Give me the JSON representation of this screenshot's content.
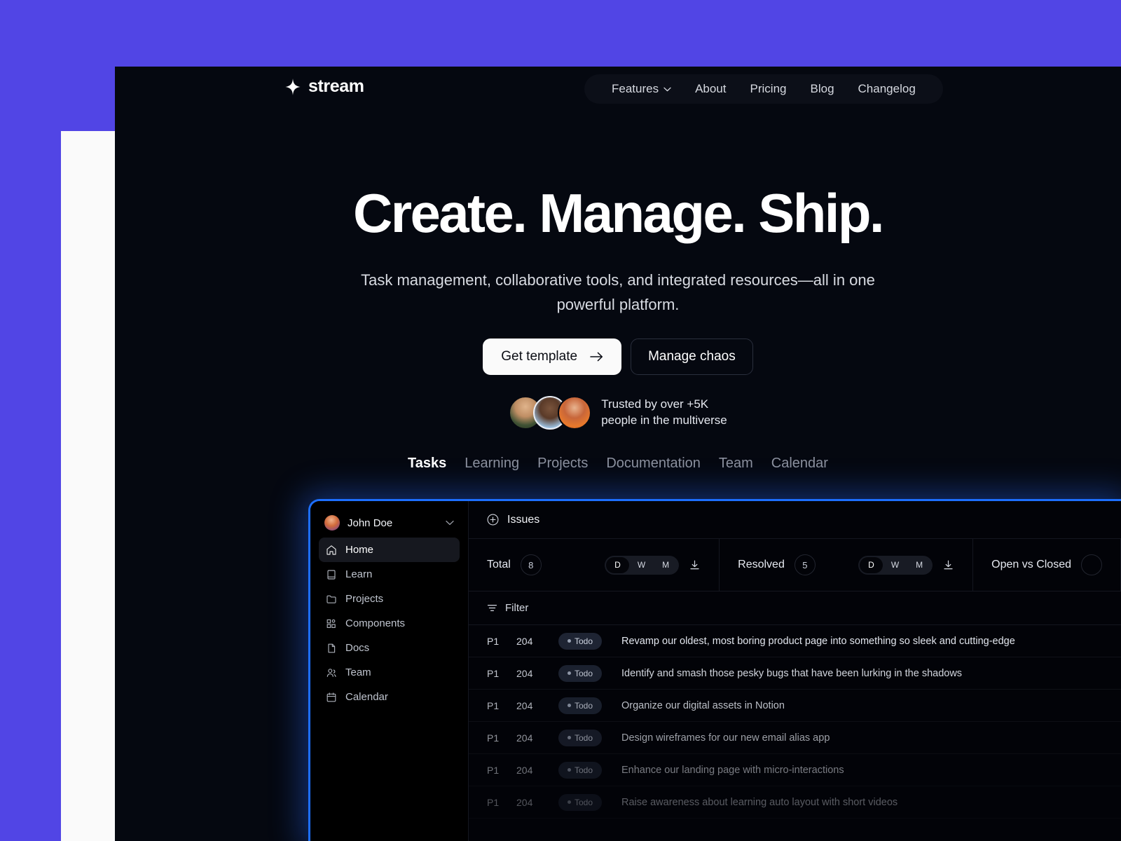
{
  "brand": {
    "name": "stream",
    "logo_icon": "sparkle-star-icon"
  },
  "nav": {
    "items": [
      {
        "label": "Features",
        "has_dropdown": true
      },
      {
        "label": "About",
        "has_dropdown": false
      },
      {
        "label": "Pricing",
        "has_dropdown": false
      },
      {
        "label": "Blog",
        "has_dropdown": false
      },
      {
        "label": "Changelog",
        "has_dropdown": false
      }
    ]
  },
  "hero": {
    "title": "Create. Manage. Ship.",
    "subtitle": "Task management, collaborative tools, and integrated resources—all in one powerful platform.",
    "primary_cta": "Get template",
    "primary_cta_icon": "arrow-right-icon",
    "secondary_cta": "Manage chaos",
    "trust_line_1": "Trusted by over +5K",
    "trust_line_2": "people in the multiverse"
  },
  "feature_tabs": [
    {
      "label": "Tasks",
      "active": true
    },
    {
      "label": "Learning",
      "active": false
    },
    {
      "label": "Projects",
      "active": false
    },
    {
      "label": "Documentation",
      "active": false
    },
    {
      "label": "Team",
      "active": false
    },
    {
      "label": "Calendar",
      "active": false
    }
  ],
  "dashboard": {
    "user": {
      "name": "John Doe",
      "chevron_icon": "chevron-down-icon"
    },
    "sidebar": [
      {
        "label": "Home",
        "icon": "home-icon",
        "active": true
      },
      {
        "label": "Learn",
        "icon": "book-icon",
        "active": false
      },
      {
        "label": "Projects",
        "icon": "folder-icon",
        "active": false
      },
      {
        "label": "Components",
        "icon": "components-grid-icon",
        "active": false
      },
      {
        "label": "Docs",
        "icon": "document-icon",
        "active": false
      },
      {
        "label": "Team",
        "icon": "users-icon",
        "active": false
      },
      {
        "label": "Calendar",
        "icon": "calendar-icon",
        "active": false
      }
    ],
    "issues_header": {
      "label": "Issues",
      "add_icon": "plus-circle-icon"
    },
    "stats": [
      {
        "label": "Total",
        "value": "8",
        "ranges": [
          "D",
          "W",
          "M"
        ],
        "selected_range": "D",
        "download_icon": "download-icon"
      },
      {
        "label": "Resolved",
        "value": "5",
        "ranges": [
          "D",
          "W",
          "M"
        ],
        "selected_range": "D",
        "download_icon": "download-icon"
      },
      {
        "label": "Open vs Closed",
        "value": "",
        "ranges": [],
        "selected_range": "",
        "download_icon": ""
      }
    ],
    "filter": {
      "label": "Filter",
      "icon": "filter-icon"
    },
    "issues": [
      {
        "priority": "P1",
        "number": "204",
        "status": "Todo",
        "title": "Revamp our oldest, most boring product page into something so sleek and cutting-edge"
      },
      {
        "priority": "P1",
        "number": "204",
        "status": "Todo",
        "title": "Identify and smash those pesky bugs that have been lurking in the shadows"
      },
      {
        "priority": "P1",
        "number": "204",
        "status": "Todo",
        "title": "Organize our digital assets in Notion"
      },
      {
        "priority": "P1",
        "number": "204",
        "status": "Todo",
        "title": "Design wireframes for our new email alias app"
      },
      {
        "priority": "P1",
        "number": "204",
        "status": "Todo",
        "title": "Enhance our landing page with micro-interactions"
      },
      {
        "priority": "P1",
        "number": "204",
        "status": "Todo",
        "title": "Raise awareness about learning auto layout with short videos"
      }
    ]
  },
  "colors": {
    "page_background": "#5145E5",
    "panel_background": "#050810",
    "accent_blue": "#1D6FFF",
    "white_block": "#FAFAFA"
  }
}
